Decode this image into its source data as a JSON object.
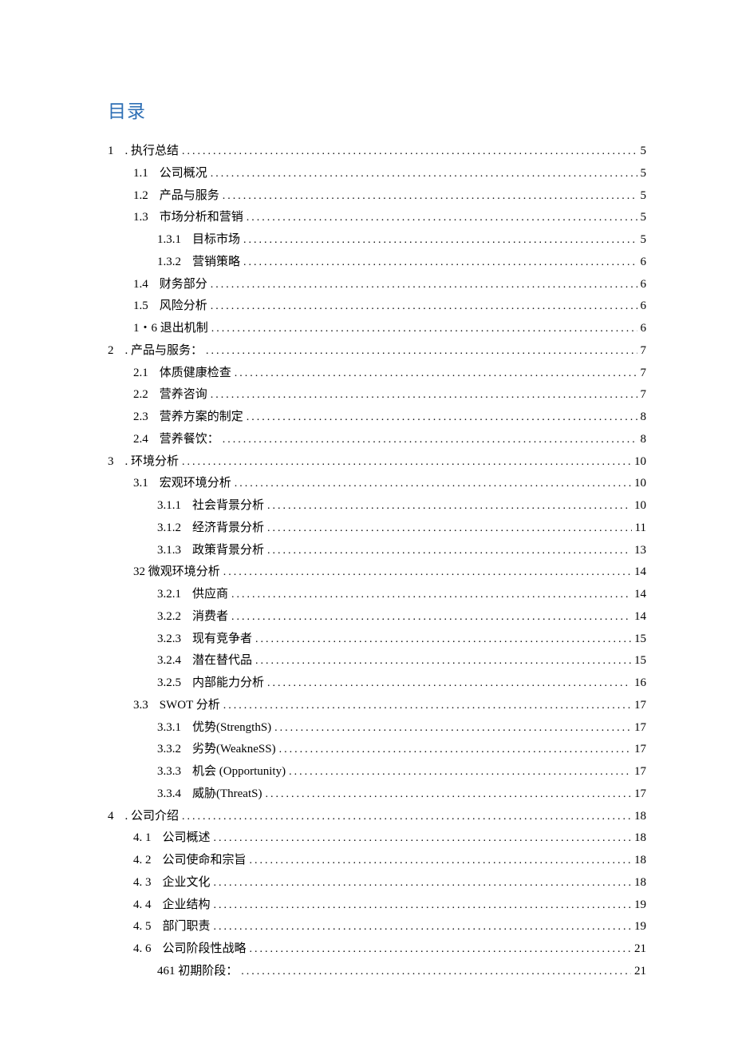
{
  "title": "目录",
  "entries": [
    {
      "indent": 0,
      "num": "1",
      "text": ". 执行总结",
      "page": "5"
    },
    {
      "indent": 1,
      "num": "1.1",
      "text": "公司概况",
      "page": "5"
    },
    {
      "indent": 1,
      "num": "1.2",
      "text": "产品与服务",
      "page": "5"
    },
    {
      "indent": 1,
      "num": "1.3",
      "text": "市场分析和营销",
      "page": "5"
    },
    {
      "indent": 2,
      "num": "1.3.1",
      "text": "目标市场",
      "page": "5"
    },
    {
      "indent": 2,
      "num": "1.3.2",
      "text": "营销策略",
      "page": "6"
    },
    {
      "indent": 1,
      "num": "1.4",
      "text": "财务部分",
      "page": "6"
    },
    {
      "indent": 1,
      "num": "1.5",
      "text": "风险分析",
      "page": "6"
    },
    {
      "indent": 1,
      "num": "",
      "text": "1・6 退出机制",
      "page": "6"
    },
    {
      "indent": 0,
      "num": "2",
      "text": ". 产品与服务：",
      "page": "7"
    },
    {
      "indent": 1,
      "num": "2.1",
      "text": "体质健康检查",
      "page": "7"
    },
    {
      "indent": 1,
      "num": "2.2",
      "text": "营养咨询",
      "page": "7"
    },
    {
      "indent": 1,
      "num": "2.3",
      "text": "营养方案的制定",
      "page": "8"
    },
    {
      "indent": 1,
      "num": "2.4",
      "text": "营养餐饮：",
      "page": "8"
    },
    {
      "indent": 0,
      "num": "3",
      "text": ". 环境分析",
      "page": "10"
    },
    {
      "indent": 1,
      "num": "3.1",
      "text": "宏观环境分析",
      "page": "10"
    },
    {
      "indent": 2,
      "num": "3.1.1",
      "text": "社会背景分析",
      "page": "10"
    },
    {
      "indent": 2,
      "num": "3.1.2",
      "text": "经济背景分析",
      "page": "11"
    },
    {
      "indent": 2,
      "num": "3.1.3",
      "text": "政策背景分析",
      "page": "13"
    },
    {
      "indent": 1,
      "num": "",
      "text": "32 微观环境分析",
      "page": "14"
    },
    {
      "indent": 2,
      "num": "3.2.1",
      "text": "供应商",
      "page": "14"
    },
    {
      "indent": 2,
      "num": "3.2.2",
      "text": "消费者",
      "page": "14"
    },
    {
      "indent": 2,
      "num": "3.2.3",
      "text": "现有竞争者",
      "page": "15"
    },
    {
      "indent": 2,
      "num": "3.2.4",
      "text": "潜在替代品",
      "page": "15"
    },
    {
      "indent": 2,
      "num": "3.2.5",
      "text": "内部能力分析",
      "page": "16"
    },
    {
      "indent": 1,
      "num": "3.3",
      "text": "SWOT 分析",
      "page": "17"
    },
    {
      "indent": 2,
      "num": "3.3.1",
      "text": "优势(StrengthS)",
      "page": "17"
    },
    {
      "indent": 2,
      "num": "3.3.2",
      "text": "劣势(WeakneSS)",
      "page": "17"
    },
    {
      "indent": 2,
      "num": "3.3.3",
      "text": "机会  (Opportunity)",
      "page": "17"
    },
    {
      "indent": 2,
      "num": "3.3.4",
      "text": "威胁(ThreatS)",
      "page": "17"
    },
    {
      "indent": 0,
      "num": "4",
      "text": ". 公司介绍",
      "page": "18"
    },
    {
      "indent": 1,
      "num": "4. 1",
      "text": "公司概述",
      "page": "18"
    },
    {
      "indent": 1,
      "num": "4. 2",
      "text": "公司使命和宗旨",
      "page": "18"
    },
    {
      "indent": 1,
      "num": "4. 3",
      "text": "企业文化",
      "page": "18"
    },
    {
      "indent": 1,
      "num": "4. 4",
      "text": "企业结构",
      "page": "19"
    },
    {
      "indent": 1,
      "num": "4. 5",
      "text": "部门职责",
      "page": "19"
    },
    {
      "indent": 1,
      "num": "4. 6",
      "text": "公司阶段性战略",
      "page": "21"
    },
    {
      "indent": 2,
      "num": "",
      "text": "461 初期阶段：",
      "page": "21"
    }
  ]
}
